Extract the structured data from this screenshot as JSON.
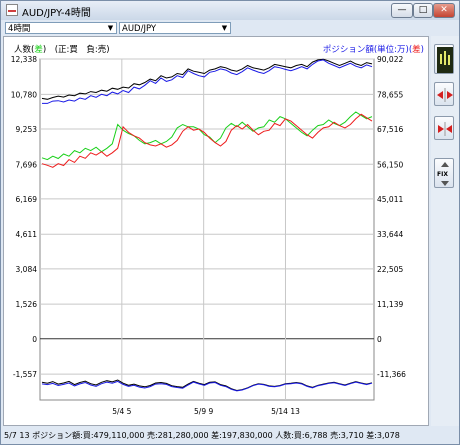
{
  "window": {
    "title": "AUD/JPY-4時間",
    "minimize_label": "—",
    "maximize_label": "□",
    "close_label": "✕"
  },
  "toolbar": {
    "timeframe_value": "4時間",
    "pair_value": "AUD/JPY"
  },
  "legend": {
    "left_prefix": "人数",
    "left_key": "差",
    "left_suffix": ")",
    "left_middle": "(正:買",
    "left_right": "負:売)",
    "right_prefix": "ポジション額(単位:万)(",
    "right_key": "差",
    "right_suffix": ")"
  },
  "sidebar": {
    "fix_label": "FIX"
  },
  "status": {
    "text": "5/7 13  ポジション額:買:479,110,000 売:281,280,000 差:197,830,000 人数:買:6,788 売:3,710 差:3,078"
  },
  "colors": {
    "black": "#000000",
    "blue": "#1a1ae6",
    "green": "#19d019",
    "red": "#ee1c1c",
    "grid": "#c8c8c8"
  },
  "chart_data": {
    "type": "line",
    "left_axis": {
      "ticks": [
        "12,338",
        "10,780",
        "9,253",
        "7,696",
        "6,169",
        "4,611",
        "3,084",
        "1,526",
        "0",
        "-1,557"
      ]
    },
    "right_axis": {
      "ticks": [
        "90,022",
        "78,655",
        "67,516",
        "56,150",
        "45,011",
        "33,644",
        "22,505",
        "11,139",
        "0",
        "-11,366"
      ]
    },
    "x_ticks": [
      "5/4 5",
      "5/9 9",
      "5/14 13"
    ],
    "series": [
      {
        "color": "black",
        "values": [
          10600,
          10560,
          10640,
          10700,
          10660,
          10750,
          10720,
          10830,
          10800,
          10900,
          10860,
          10960,
          10920,
          11050,
          11000,
          11100,
          11060,
          11250,
          11200,
          11300,
          11450,
          11380,
          11600,
          11500,
          11550,
          11700,
          11650,
          11900,
          11800,
          11750,
          11700,
          11850,
          11900,
          12000,
          11950,
          11850,
          11800,
          11900,
          12050,
          11950,
          11900,
          11850,
          11950,
          12100,
          12050,
          12000,
          11950,
          12050,
          12100,
          12000,
          12200,
          12300,
          12330,
          12250,
          12150,
          12050,
          12150,
          12250,
          12120,
          12050,
          12180,
          12120
        ]
      },
      {
        "color": "blue",
        "values": [
          10380,
          10380,
          10480,
          10500,
          10440,
          10530,
          10480,
          10620,
          10560,
          10720,
          10650,
          10780,
          10720,
          10880,
          10800,
          10950,
          10860,
          11100,
          11020,
          11180,
          11380,
          11260,
          11500,
          11350,
          11420,
          11600,
          11520,
          11820,
          11700,
          11600,
          11550,
          11750,
          11800,
          11900,
          11850,
          11720,
          11650,
          11780,
          11950,
          11850,
          11760,
          11700,
          11820,
          12000,
          11950,
          11880,
          11820,
          11900,
          12000,
          11900,
          12100,
          12250,
          12300,
          12150,
          12050,
          11950,
          12050,
          12150,
          12020,
          11950,
          12080,
          12000
        ]
      },
      {
        "color": "green",
        "values": [
          7980,
          7900,
          8050,
          7950,
          8150,
          8050,
          8300,
          8200,
          8400,
          8300,
          8450,
          8250,
          8400,
          8600,
          9450,
          9200,
          9050,
          8950,
          8750,
          8600,
          8650,
          8750,
          8600,
          8700,
          8900,
          9300,
          9450,
          9350,
          9350,
          9250,
          9000,
          8900,
          8650,
          8850,
          9300,
          9500,
          9350,
          9550,
          9350,
          9150,
          9300,
          9350,
          9650,
          9550,
          9800,
          9700,
          9500,
          9300,
          9100,
          8950,
          9200,
          9400,
          9450,
          9650,
          9500,
          9400,
          9550,
          9800,
          10000,
          9850,
          9700,
          9800
        ]
      },
      {
        "color": "red",
        "values": [
          7720,
          7650,
          7560,
          7720,
          7640,
          7900,
          7780,
          8050,
          7960,
          8200,
          8100,
          8250,
          8050,
          8200,
          8400,
          9350,
          9100,
          8950,
          8850,
          8650,
          8550,
          8500,
          8600,
          8450,
          8550,
          8750,
          9150,
          9350,
          9200,
          9250,
          9100,
          8850,
          8650,
          8500,
          8700,
          9200,
          9400,
          9250,
          9450,
          9200,
          9000,
          9150,
          9200,
          9500,
          9400,
          9700,
          9600,
          9400,
          9200,
          9000,
          8850,
          9100,
          9300,
          9350,
          9550,
          9400,
          9300,
          9450,
          9700,
          9900,
          9750,
          9600
        ]
      },
      {
        "color": "black",
        "values": [
          -1920,
          -1960,
          -1890,
          -2000,
          -1950,
          -1880,
          -2020,
          -1930,
          -1870,
          -1980,
          -2040,
          -1920,
          -1850,
          -1900,
          -1820,
          -1960,
          -2050,
          -2000,
          -2080,
          -2120,
          -2060,
          -1950,
          -1930,
          -1970,
          -2070,
          -2110,
          -2140,
          -2000,
          -1880,
          -1960,
          -2020,
          -1920,
          -1900,
          -2020,
          -2080,
          -2200,
          -2280,
          -2240,
          -2160,
          -2050,
          -1980,
          -2010,
          -2080,
          -2100,
          -2060,
          -1980,
          -1960,
          -1930,
          -1970,
          -2080,
          -2140,
          -2050,
          -2000,
          -1950,
          -1920,
          -1980,
          -2040,
          -1960,
          -1890,
          -1950,
          -2000,
          -1940
        ]
      },
      {
        "color": "blue",
        "values": [
          -1990,
          -2020,
          -1970,
          -2060,
          -2010,
          -1950,
          -2080,
          -1990,
          -1930,
          -2040,
          -2100,
          -1980,
          -1910,
          -1960,
          -1880,
          -2010,
          -2100,
          -2050,
          -2130,
          -2170,
          -2110,
          -2000,
          -1980,
          -2010,
          -2110,
          -2150,
          -2180,
          -2040,
          -1910,
          -1990,
          -2050,
          -1950,
          -1930,
          -2050,
          -2110,
          -2230,
          -2300,
          -2260,
          -2180,
          -2070,
          -2000,
          -2030,
          -2100,
          -2120,
          -2080,
          -2000,
          -1980,
          -1950,
          -1990,
          -2100,
          -2160,
          -2070,
          -2020,
          -1970,
          -1940,
          -2000,
          -2060,
          -1980,
          -1910,
          -1970,
          -2020,
          -1960
        ]
      }
    ]
  }
}
